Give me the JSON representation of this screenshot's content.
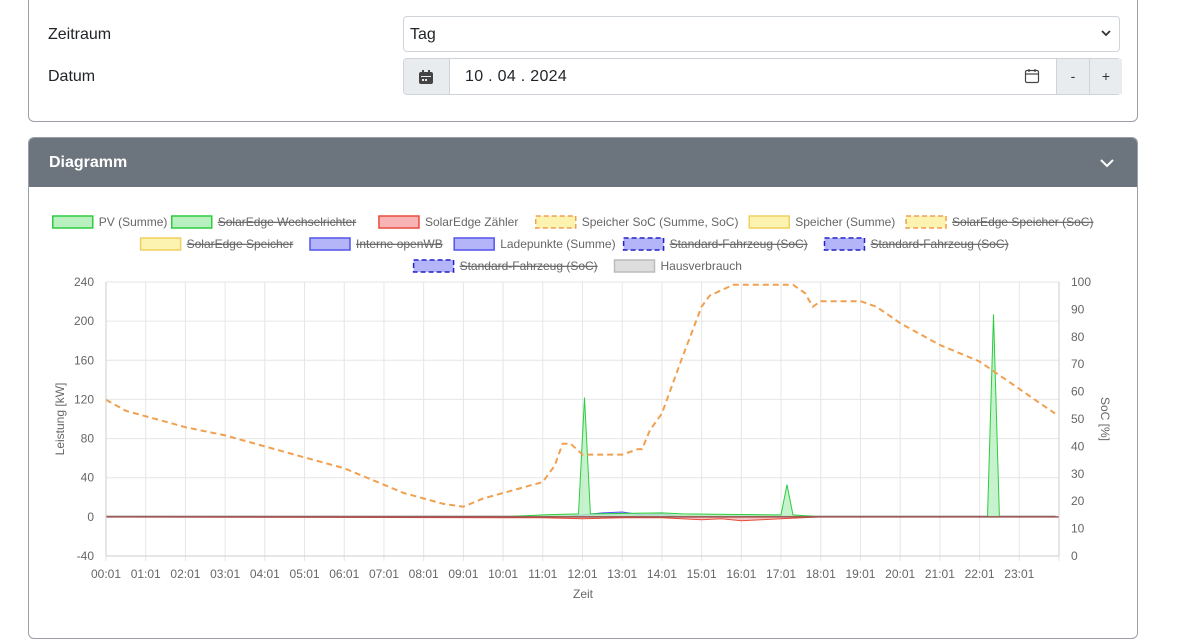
{
  "form": {
    "zeitraum_label": "Zeitraum",
    "zeitraum_value": "Tag",
    "datum_label": "Datum",
    "datum_value": "10 . 04 . 2024",
    "minus_label": "-",
    "plus_label": "+"
  },
  "panel": {
    "title": "Diagramm"
  },
  "colors": {
    "header_bg": "#6c757d",
    "pv": "#2ecc40",
    "meter": "#e74c3c",
    "soc": "#f0a050",
    "battery": "#f5e663",
    "charge": "#6666ff",
    "house": "#bbbbbb"
  },
  "chart_data": {
    "type": "area",
    "xlabel": "Zeit",
    "ylabel": "Leistung [kW]",
    "y2label": "SoC [%]",
    "ylim": [
      -40,
      240
    ],
    "y2lim": [
      0,
      100
    ],
    "yticks": [
      240,
      200,
      160,
      120,
      80,
      40,
      0,
      -40
    ],
    "y2ticks": [
      100,
      90,
      80,
      70,
      60,
      50,
      40,
      30,
      20,
      10,
      0
    ],
    "xticks": [
      "00:01",
      "01:01",
      "02:01",
      "03:01",
      "04:01",
      "05:01",
      "06:01",
      "07:01",
      "08:01",
      "09:01",
      "10:01",
      "11:01",
      "12:01",
      "13:01",
      "14:01",
      "15:01",
      "16:01",
      "17:01",
      "18:01",
      "19:01",
      "20:01",
      "21:01",
      "22:01",
      "23:01"
    ],
    "grid": true,
    "legend_position": "top",
    "legend": [
      {
        "name": "PV (Summe)",
        "hidden": false,
        "fill": "#b8f0c0",
        "stroke": "#2ecc40",
        "dashed": false
      },
      {
        "name": "SolarEdge Wechselrichter",
        "hidden": true,
        "fill": "#b8f0c0",
        "stroke": "#2ecc40",
        "dashed": false
      },
      {
        "name": "SolarEdge Zähler",
        "hidden": false,
        "fill": "#f8b4b4",
        "stroke": "#e74c3c",
        "dashed": false
      },
      {
        "name": "Speicher SoC (Summe, SoC)",
        "hidden": false,
        "fill": "#fcf3b0",
        "stroke": "#f0a050",
        "dashed": true
      },
      {
        "name": "Speicher (Summe)",
        "hidden": false,
        "fill": "#fcf3b0",
        "stroke": "#f0d060",
        "dashed": false
      },
      {
        "name": "SolarEdge Speicher (SoC)",
        "hidden": true,
        "fill": "#fcf3b0",
        "stroke": "#f0a050",
        "dashed": true
      },
      {
        "name": "SolarEdge Speicher",
        "hidden": true,
        "fill": "#fcf3b0",
        "stroke": "#f0d060",
        "dashed": false
      },
      {
        "name": "Interne openWB",
        "hidden": true,
        "fill": "#b4b4f8",
        "stroke": "#5555ee",
        "dashed": false
      },
      {
        "name": "Ladepunkte (Summe)",
        "hidden": false,
        "fill": "#b4b4f8",
        "stroke": "#5555ee",
        "dashed": false
      },
      {
        "name": "Standard-Fahrzeug (SoC)",
        "hidden": true,
        "fill": "#b4b4f8",
        "stroke": "#2222cc",
        "dashed": true
      },
      {
        "name": "Standard-Fahrzeug (SoC)",
        "hidden": true,
        "fill": "#b4b4f8",
        "stroke": "#2222cc",
        "dashed": true
      },
      {
        "name": "Standard-Fahrzeug (SoC)",
        "hidden": true,
        "fill": "#b4b4f8",
        "stroke": "#2222cc",
        "dashed": true
      },
      {
        "name": "Hausverbrauch",
        "hidden": false,
        "fill": "#dddddd",
        "stroke": "#bbbbbb",
        "dashed": false
      }
    ],
    "series": [
      {
        "name": "Speicher SoC (Summe, SoC)",
        "axis": "y2",
        "x": [
          0.0,
          0.5,
          1.0,
          1.5,
          2.0,
          3.0,
          3.5,
          4.0,
          5.0,
          6.0,
          6.5,
          7.0,
          7.5,
          8.0,
          8.5,
          9.0,
          9.5,
          10.0,
          10.5,
          11.0,
          11.3,
          11.5,
          11.7,
          12.0,
          12.5,
          13.0,
          13.4,
          13.5,
          13.7,
          14.0,
          14.5,
          15.0,
          15.2,
          15.5,
          15.8,
          16.0,
          16.5,
          17.0,
          17.3,
          17.6,
          17.8,
          18.0,
          18.5,
          19.0,
          19.4,
          19.7,
          20.0,
          20.5,
          21.0,
          21.5,
          22.0,
          22.5,
          23.0,
          23.5,
          23.9
        ],
        "y": [
          57,
          53,
          51,
          49,
          47,
          44,
          42,
          40,
          36,
          32,
          29,
          26,
          23,
          21,
          19,
          18,
          21,
          23,
          25,
          27,
          33,
          41,
          41,
          37,
          37,
          37,
          39,
          39,
          46,
          52,
          72,
          91,
          95,
          97,
          99,
          99,
          99,
          99,
          99,
          96,
          91,
          93,
          93,
          93,
          91,
          88,
          85,
          81,
          77,
          74,
          71,
          66,
          61,
          56,
          52
        ]
      },
      {
        "name": "PV (Summe)",
        "axis": "y",
        "x": [
          0,
          10.0,
          11.0,
          11.9,
          12.05,
          12.2,
          14.0,
          14.5,
          17.0,
          17.15,
          17.3,
          18.0,
          22.2,
          22.35,
          22.5,
          23.9
        ],
        "y": [
          0,
          0,
          2,
          3,
          122,
          3,
          4,
          3,
          2,
          33,
          2,
          0,
          0,
          207,
          0,
          0
        ]
      },
      {
        "name": "SolarEdge Zähler",
        "axis": "y",
        "x": [
          0,
          11.0,
          12.0,
          13.0,
          14.0,
          15.0,
          15.5,
          16.0,
          16.5,
          17.0,
          18.0,
          23.9
        ],
        "y": [
          0,
          -1,
          -2,
          -1,
          -1,
          -3,
          -2,
          -4,
          -3,
          -2,
          0,
          0
        ]
      },
      {
        "name": "Ladepunkte (Summe)",
        "axis": "y",
        "x": [
          0,
          11.5,
          12.5,
          13.0,
          13.5,
          14.0,
          14.5,
          23.9
        ],
        "y": [
          0,
          0,
          4,
          5,
          2,
          3,
          0,
          0
        ]
      },
      {
        "name": "Hausverbrauch",
        "axis": "y",
        "x": [
          0,
          6.0,
          12.0,
          18.0,
          23.9
        ],
        "y": [
          1,
          1,
          1,
          1,
          1
        ]
      }
    ]
  }
}
